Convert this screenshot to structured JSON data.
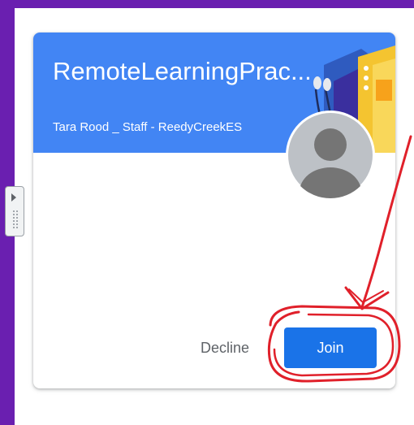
{
  "invite_card": {
    "class_name": "RemoteLearningPrac...",
    "teacher": "Tara Rood _ Staff - ReedyCreekES",
    "decline_label": "Decline",
    "join_label": "Join",
    "banner_color": "#4285f4",
    "join_color": "#1a73e8",
    "annotation_color": "#e0202a"
  },
  "icons": {
    "side_panel": "chevron-right-icon",
    "more": "more-vert-icon",
    "avatar": "default-avatar-icon"
  }
}
